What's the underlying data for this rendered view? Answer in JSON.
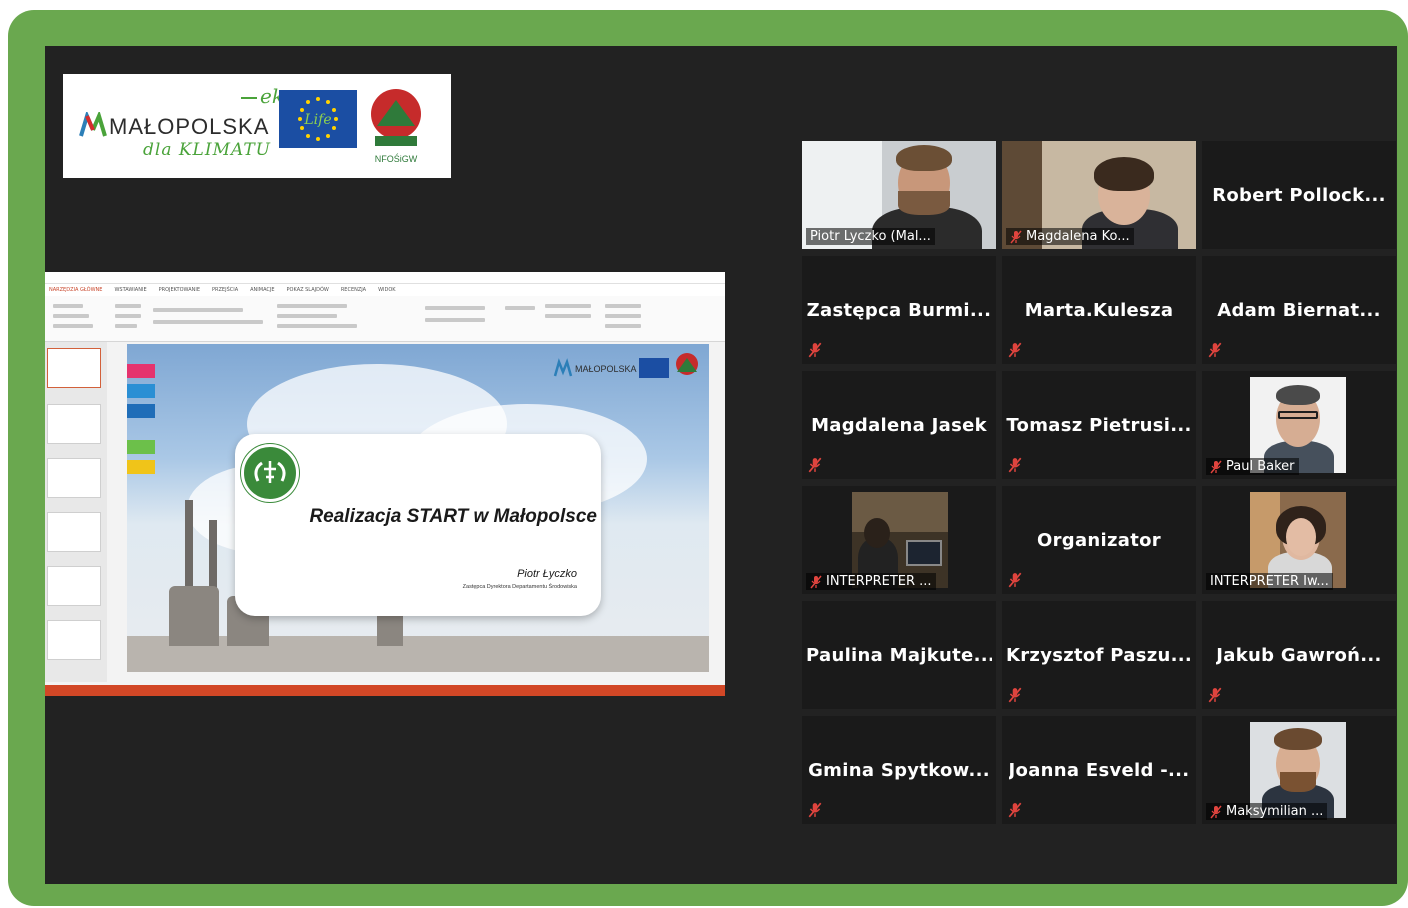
{
  "logo_banner": {
    "eko": "eko",
    "malopolska": "MAŁOPOLSKA",
    "dla_klimatu": "dla KLIMATU",
    "eu_life_text": "Life",
    "nfosigw": "NFOŚiGW"
  },
  "powerpoint": {
    "tabs": [
      "NARZĘDZIA GŁÓWNE",
      "WSTAWIANIE",
      "PROJEKTOWANIE",
      "PRZEJŚCIA",
      "ANIMACJE",
      "POKAZ SLAJDÓW",
      "RECENZJA",
      "WIDOK"
    ],
    "slide": {
      "title": "Realizacja START w Małopolsce",
      "author": "Piotr Łyczko",
      "role": "Zastępca Dyrektora Departamentu Środowiska",
      "banner_text": "MAŁOPOLSKA"
    }
  },
  "participants": [
    {
      "name": "Piotr Lyczko (Mal...",
      "video": true,
      "muted": false,
      "active": true
    },
    {
      "name": "Magdalena Ko...",
      "video": true,
      "muted": true,
      "active": false
    },
    {
      "name": "Robert Pollock...",
      "video": false,
      "muted": false,
      "active": false
    },
    {
      "name": "Zastępca Burmi...",
      "video": false,
      "muted": true,
      "active": false
    },
    {
      "name": "Marta.Kulesza",
      "video": false,
      "muted": true,
      "active": false
    },
    {
      "name": "Adam Biernat...",
      "video": false,
      "muted": true,
      "active": false
    },
    {
      "name": "Magdalena Jasek",
      "video": false,
      "muted": true,
      "active": false
    },
    {
      "name": "Tomasz Pietrusi...",
      "video": false,
      "muted": true,
      "active": false
    },
    {
      "name": "Paul Baker",
      "video": true,
      "muted": true,
      "active": false
    },
    {
      "name": "INTERPRETER ...",
      "video": true,
      "muted": true,
      "active": false
    },
    {
      "name": "Organizator",
      "video": false,
      "muted": true,
      "active": false
    },
    {
      "name": "INTERPRETER Iw...",
      "video": true,
      "muted": false,
      "active": false
    },
    {
      "name": "Paulina Majkute...",
      "video": false,
      "muted": false,
      "active": false
    },
    {
      "name": "Krzysztof Paszu...",
      "video": false,
      "muted": true,
      "active": false
    },
    {
      "name": "Jakub Gawroń...",
      "video": false,
      "muted": true,
      "active": false
    },
    {
      "name": "Gmina Spytkow...",
      "video": false,
      "muted": true,
      "active": false
    },
    {
      "name": "Joanna Esveld -...",
      "video": false,
      "muted": true,
      "active": false
    },
    {
      "name": "Maksymilian ...",
      "video": true,
      "muted": true,
      "active": false
    }
  ],
  "colors": {
    "frame": "#6aa84f",
    "background": "#222222",
    "tile": "#1a1a1a",
    "active_outline": "#c8e06a",
    "mute_icon": "#e0443e"
  }
}
